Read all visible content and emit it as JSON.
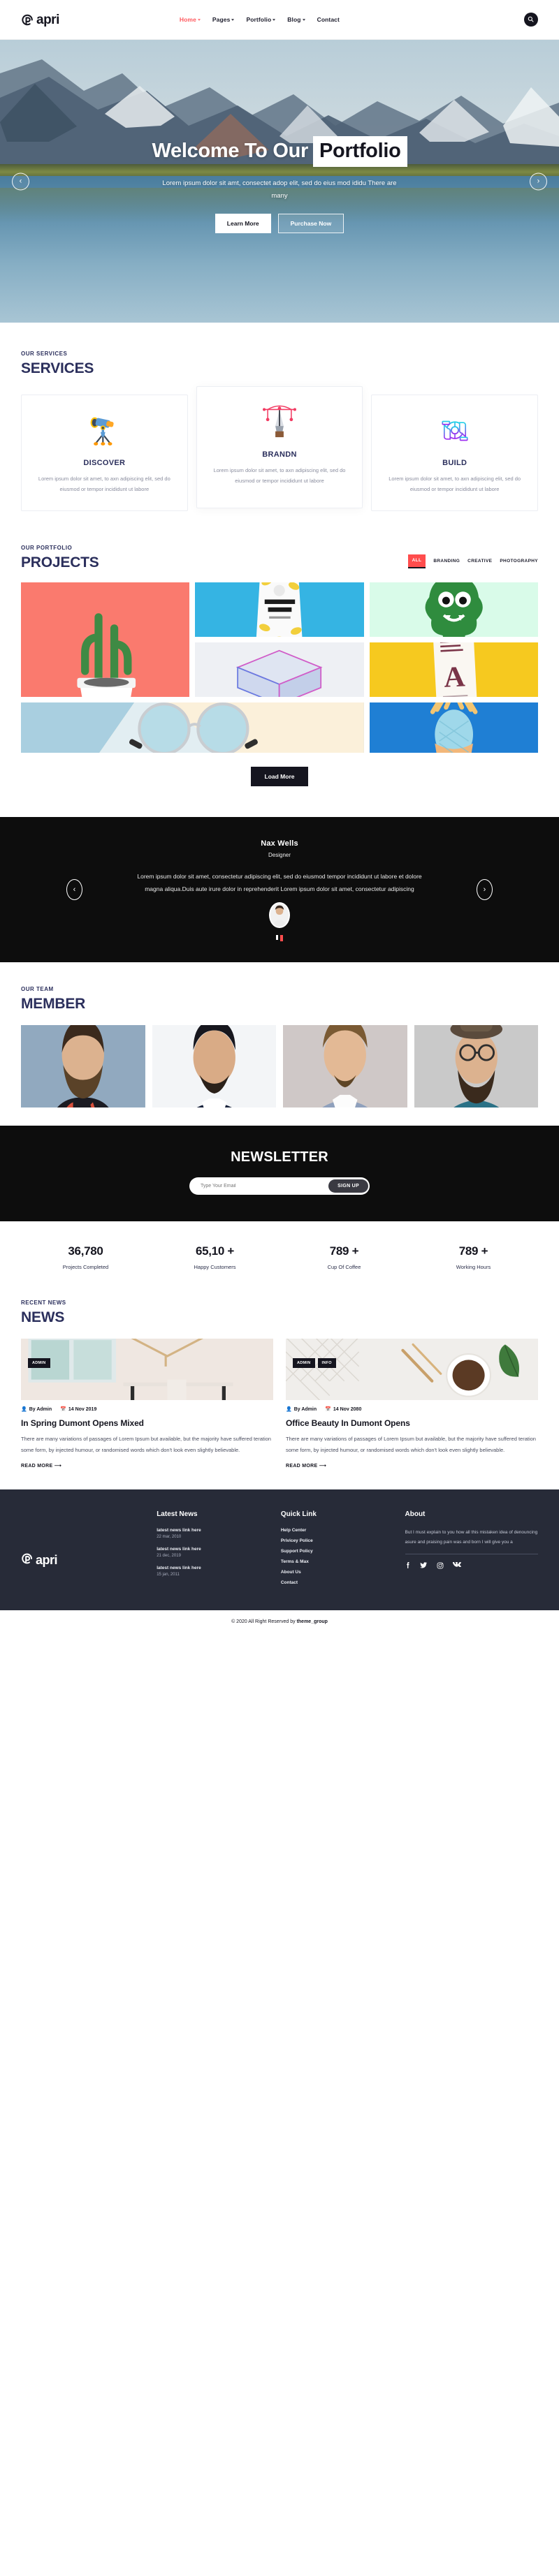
{
  "brand": {
    "name": "apri",
    "logo_icon": "apri-p-mark-icon"
  },
  "header": {
    "nav": [
      {
        "label": "Home",
        "has_caret": true,
        "active": true
      },
      {
        "label": "Pages",
        "has_caret": true,
        "active": false
      },
      {
        "label": "Portfolio",
        "has_caret": true,
        "active": false
      },
      {
        "label": "Blog",
        "has_caret": true,
        "active": false
      },
      {
        "label": "Contact",
        "has_caret": false,
        "active": false
      }
    ],
    "search_icon": "search-icon"
  },
  "hero": {
    "title_plain": "Welcome To Our",
    "title_highlight": "Portfolio",
    "subtitle": "Lorem ipsum dolor sit amt, consectet adop elit, sed do eius mod ididu There are many",
    "primary_button": "Learn More",
    "secondary_button": "Purchase Now",
    "prev_icon": "chevron-left-icon",
    "next_icon": "chevron-right-icon"
  },
  "services": {
    "eyebrow": "OUR SERVICES",
    "title": "SERVICES",
    "cards": [
      {
        "icon": "telescope-icon",
        "name": "DISCOVER",
        "desc": "Lorem ipsum dolor sit amet, to axn adipiscing elit, sed do eiusmod or tempor incididunt ut labore"
      },
      {
        "icon": "pen-nib-icon",
        "name": "BRANDN",
        "desc": "Lorem ipsum dolor sit amet, to axn adipiscing elit, sed do eiusmod or tempor incididunt ut labore"
      },
      {
        "icon": "hands-gear-icon",
        "name": "BUILD",
        "desc": "Lorem ipsum dolor sit amet, to axn adipiscing elit, sed do eiusmod or tempor incididunt ut labore"
      }
    ]
  },
  "portfolio": {
    "eyebrow": "OUR PORTFOLIO",
    "title": "PROJECTS",
    "filters": [
      {
        "label": "ALL",
        "active": true
      },
      {
        "label": "BRANDING",
        "active": false
      },
      {
        "label": "CREATIVE",
        "active": false
      },
      {
        "label": "PHOTOGRAPHY",
        "active": false
      }
    ],
    "items": [
      {
        "name": "cactus-in-white-pot"
      },
      {
        "name": "plastic-pouch-packaging-mockup"
      },
      {
        "name": "green-monster-character"
      },
      {
        "name": "translucent-gradient-box"
      },
      {
        "name": "brochure-letter-a-mockup"
      },
      {
        "name": "round-sunglasses"
      },
      {
        "name": "painted-pineapple"
      }
    ],
    "load_more": "Load More"
  },
  "testimonial": {
    "name": "Nax Wells",
    "role": "Designer",
    "quote": "Lorem ipsum dolor sit amet, consectetur adipiscing elit, sed do eiusmod tempor incididunt ut labore et dolore magna aliqua.Duis aute irure dolor in reprehenderit Lorem ipsum dolor sit amet, consectetur adipiscing",
    "avatar": "testimonial-avatar",
    "prev_icon": "chevron-left-icon",
    "next_icon": "chevron-right-icon",
    "dots": [
      false,
      true
    ]
  },
  "team": {
    "eyebrow": "OUR TEAM",
    "title": "MEMBER",
    "members": [
      {
        "photo": "team-member-1-photo"
      },
      {
        "photo": "team-member-2-photo"
      },
      {
        "photo": "team-member-3-photo"
      },
      {
        "photo": "team-member-4-photo"
      }
    ]
  },
  "newsletter": {
    "title": "NEWSLETTER",
    "placeholder": "Type Your Email",
    "value": "",
    "button": "SIGN UP"
  },
  "stats": [
    {
      "number": "36,780",
      "label": "Projects Completed"
    },
    {
      "number": "65,10 +",
      "label": "Happy Customers"
    },
    {
      "number": "789 +",
      "label": "Cup Of Coffee"
    },
    {
      "number": "789 +",
      "label": "Working Hours"
    }
  ],
  "news": {
    "eyebrow": "RECENT NEWS",
    "title": "NEWS",
    "posts": [
      {
        "tags": [
          "ADMIN"
        ],
        "author": "By Admin",
        "date": "14 Nov 2019",
        "title": "In Spring Dumont Opens Mixed",
        "text": "There are many variations of passages of Lorem Ipsum but available, but the majority have suffered teration some form, by injected humour, or randomised words which don't look even slightly believable.",
        "read_more": "READ MORE"
      },
      {
        "tags": [
          "ADMIN",
          "INFO"
        ],
        "author": "By Admin",
        "date": "14 Nov 2080",
        "title": "Office Beauty In Dumont Opens",
        "text": "There are many variations of passages of Lorem Ipsum but available, but the majority have suffered teration some form, by injected humour, or randomised words which don't look even slightly believable.",
        "read_more": "READ MORE"
      }
    ]
  },
  "footer": {
    "latest_news": {
      "heading": "Latest News",
      "items": [
        {
          "link": "latest news link here",
          "date": "22 mar, 2010"
        },
        {
          "link": "latest news link here",
          "date": "21 dec, 2019"
        },
        {
          "link": "latest news link here",
          "date": "15 jan, 2011"
        }
      ]
    },
    "quick_link": {
      "heading": "Quick Link",
      "items": [
        "Help Center",
        "Privicey Police",
        "Support Policy",
        "Terms & Max",
        "About Us",
        "Contact"
      ]
    },
    "about": {
      "heading": "About",
      "text": "But I must explain to you how all this mistaken idea of denouncing asure and praising pain was and born I will give you a",
      "social": [
        {
          "name": "facebook-icon",
          "glyph": "f"
        },
        {
          "name": "twitter-icon",
          "glyph": "✈"
        },
        {
          "name": "instagram-icon",
          "glyph": "◎"
        },
        {
          "name": "vk-icon",
          "glyph": "ᴡ"
        }
      ]
    },
    "copyright_prefix": "© 2020 All Right Reserved by ",
    "copyright_brand": "theme_group"
  },
  "colors": {
    "accent": "#ff5a5f",
    "filter_accent": "#ff4d4d",
    "heading": "#2b2f5c",
    "dark": "#0d0d0d",
    "footer_bg": "#272b38"
  }
}
